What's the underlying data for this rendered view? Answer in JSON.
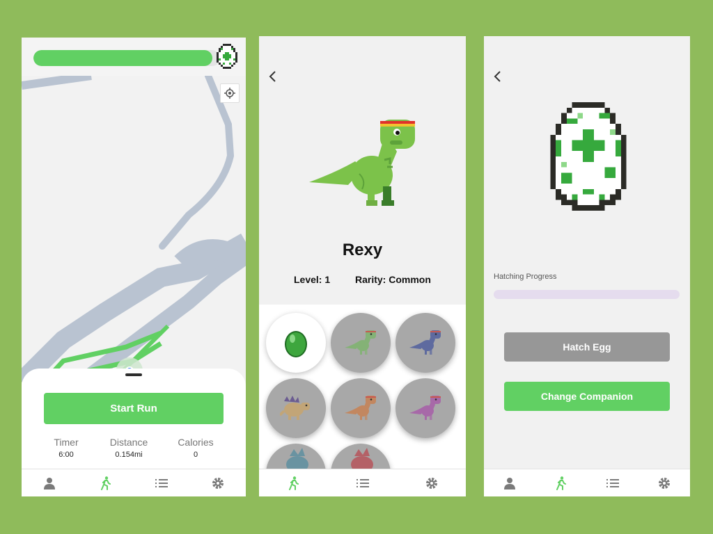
{
  "colors": {
    "background": "#8fbb5b",
    "accent": "#61d063",
    "disabled": "#979797",
    "inactive_icon": "#7a7a7a",
    "active_icon": "#61d063"
  },
  "run_screen": {
    "companion_progress": 0.96,
    "companion_icon": "pixel-egg-icon",
    "map_icon": "locate-icon",
    "start_run_label": "Start Run",
    "stats": [
      {
        "label": "Timer",
        "value": "6:00"
      },
      {
        "label": "Distance",
        "value": "0.154mi"
      },
      {
        "label": "Calories",
        "value": "0"
      }
    ],
    "nav": [
      "profile-icon",
      "run-icon",
      "list-icon",
      "settings-icon"
    ],
    "active_nav": "run-icon"
  },
  "dino_screen": {
    "name": "Rexy",
    "level": "Level: 1",
    "rarity": "Rarity: Common",
    "collection": [
      {
        "kind": "egg",
        "color": "#3ea63e",
        "selected": true
      },
      {
        "kind": "trex",
        "color": "#7cb56a",
        "selected": false
      },
      {
        "kind": "trex",
        "color": "#4c5b9e",
        "selected": false
      },
      {
        "kind": "stego",
        "color": "#c9a56b",
        "selected": false
      },
      {
        "kind": "trex",
        "color": "#c9804f",
        "selected": false
      },
      {
        "kind": "trex",
        "color": "#a75aa8",
        "selected": false
      },
      {
        "kind": "partial",
        "color": "#5a8fa0",
        "selected": false
      },
      {
        "kind": "partial",
        "color": "#b85058",
        "selected": false
      }
    ],
    "nav": [
      "run-icon",
      "list-icon",
      "settings-icon"
    ],
    "active_nav": "run-icon"
  },
  "egg_screen": {
    "hatching_label": "Hatching Progress",
    "hatching_progress": 0,
    "hatch_button": "Hatch Egg",
    "change_button": "Change Companion",
    "nav": [
      "profile-icon",
      "run-icon",
      "list-icon",
      "settings-icon"
    ],
    "active_nav": "run-icon"
  }
}
